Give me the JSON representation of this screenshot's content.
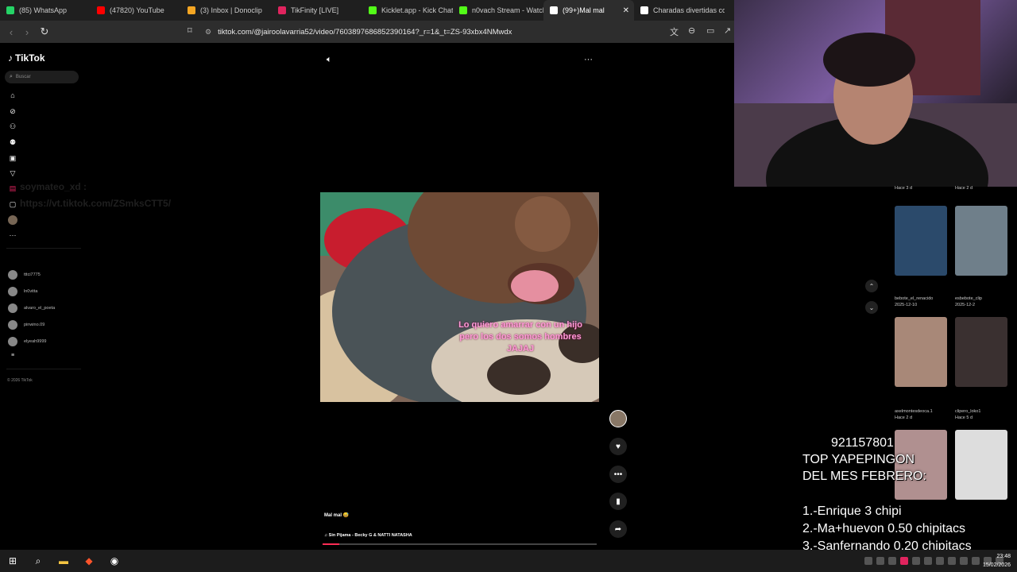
{
  "browser": {
    "tabs": [
      {
        "label": "(85) WhatsApp",
        "color": "#25d366"
      },
      {
        "label": "(47820) YouTube",
        "color": "#ff0000"
      },
      {
        "label": "(3) Inbox | Donoclip",
        "color": "#f5a623"
      },
      {
        "label": "TikFinity [LIVE]",
        "color": "#e0245e"
      },
      {
        "label": "Kicklet.app - Kick Chat",
        "color": "#53fc18"
      },
      {
        "label": "n0vach Stream - Watch",
        "color": "#53fc18"
      },
      {
        "label": "(99+)Mal mal",
        "color": "#ffffff"
      },
      {
        "label": "Charadas divertidas co",
        "color": "#ffffff"
      }
    ],
    "active_tab_index": 6,
    "url": "tiktok.com/@jairoolavarria52/video/7603897686852390164?_r=1&_t=ZS-93xbx4NMwdx"
  },
  "tiktok": {
    "logo": "TikTok",
    "search_placeholder": "Buscar",
    "nav_icons": [
      "home-icon",
      "explore-icon",
      "following-icon",
      "friends-icon",
      "live-icon",
      "upload-icon",
      "activity-icon",
      "messages-icon",
      "profile-icon",
      "more-icon"
    ],
    "ghost_text_1": "soymateo_xd :",
    "ghost_text_2": "https://vt.tiktok.com/ZSmksCTT5/",
    "following": [
      "tttci7775",
      "ln0vitta",
      "alvaro_el_poeta",
      "pinwino.09",
      "elyeah9999"
    ],
    "copyright": "© 2026 TikTok",
    "video_overlay_text": "Lo quiero amarrar con un hijo pero los dos somos hombres JAJAJ",
    "caption": "Mal mal 😅",
    "music": "♫  Sin Pijama - Becky G & NATTI NATASHA",
    "progress": 0.06
  },
  "side_videos": [
    {
      "user": "",
      "date": "Hace 3 d"
    },
    {
      "user": "",
      "date": "Hace 2 d"
    },
    {
      "user": "bebote_el_renacido",
      "date": "2025-12-10"
    },
    {
      "user": "esbebote_clip",
      "date": "2025-12-2"
    },
    {
      "user": "axelmontesdeoca.1",
      "date": "Hace 2 d"
    },
    {
      "user": "clipero_loko1",
      "date": "Hace 5 d"
    }
  ],
  "stream_overlay": {
    "number": "921157801",
    "title_line1": "TOP YAPEPINGON",
    "title_line2": "DEL MES FEBRERO:",
    "rank1": "1.-Enrique 3 chipi",
    "rank2": "2.-Ma+huevon 0.50 chipitacs",
    "rank3": "3.-Sanfernando 0.20 chipitacs"
  },
  "taskbar": {
    "time": "23:48",
    "date": "15/02/2026"
  }
}
